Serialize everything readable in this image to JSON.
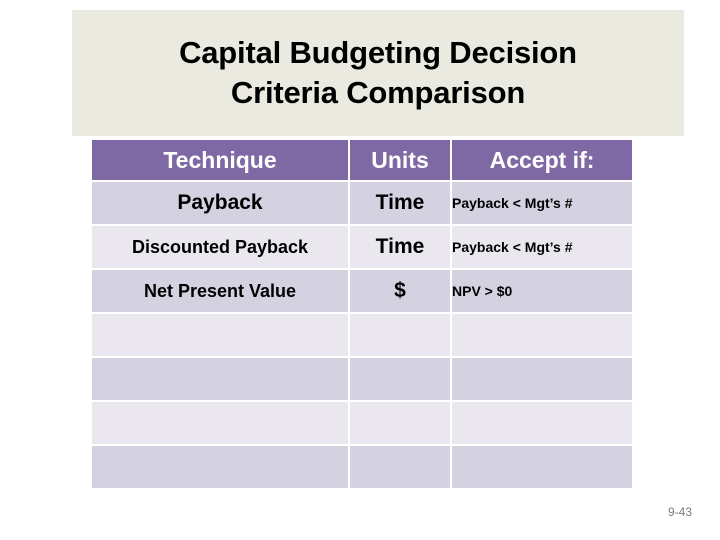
{
  "slide": {
    "title": "Capital Budgeting Decision\nCriteria Comparison",
    "number": "9-43",
    "banner_color": "#ebeae0",
    "header_color": "#7f69a4",
    "band_dark_color": "#d4d1e0",
    "band_light_color": "#eae8ee"
  },
  "table": {
    "columns": [
      {
        "key": "technique",
        "label": "Technique"
      },
      {
        "key": "units",
        "label": "Units"
      },
      {
        "key": "accept",
        "label": "Accept if:"
      }
    ],
    "rows": [
      {
        "technique": "Payback",
        "units": "Time",
        "accept": "Payback < Mgt’s #"
      },
      {
        "technique": "Discounted Payback",
        "units": "Time",
        "accept": "Payback < Mgt’s #"
      },
      {
        "technique": "Net Present Value",
        "units": "$",
        "accept": "NPV > $0"
      },
      {
        "technique": "",
        "units": "",
        "accept": ""
      },
      {
        "technique": "",
        "units": "",
        "accept": ""
      },
      {
        "technique": "",
        "units": "",
        "accept": ""
      },
      {
        "technique": "",
        "units": "",
        "accept": ""
      }
    ]
  }
}
